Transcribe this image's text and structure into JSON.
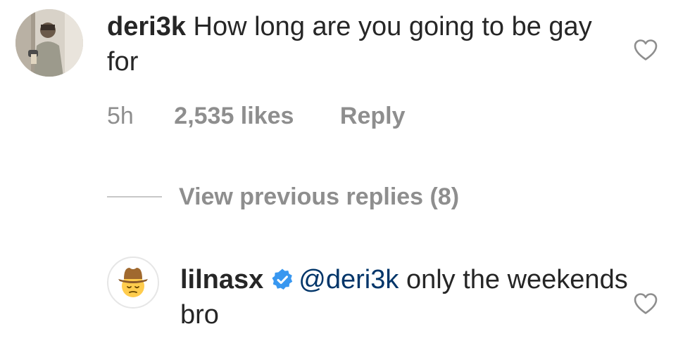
{
  "comment": {
    "username": "deri3k",
    "text": "How long are you going to be gay for",
    "avatar_icon": "user-photo-avatar",
    "time": "5h",
    "likes": "2,535 likes",
    "reply_label": "Reply",
    "like_icon": "heart-outline-icon"
  },
  "view_replies": {
    "label": "View previous replies (8)"
  },
  "reply": {
    "username": "lilnasx",
    "verified_icon": "verified-badge-icon",
    "mention": "@deri3k",
    "text": "only the weekends bro",
    "avatar_icon": "cowboy-emoji-avatar",
    "like_icon": "heart-outline-icon"
  },
  "colors": {
    "text": "#262626",
    "secondary": "#8e8e8e",
    "mention": "#003569",
    "verified": "#3897f0"
  }
}
